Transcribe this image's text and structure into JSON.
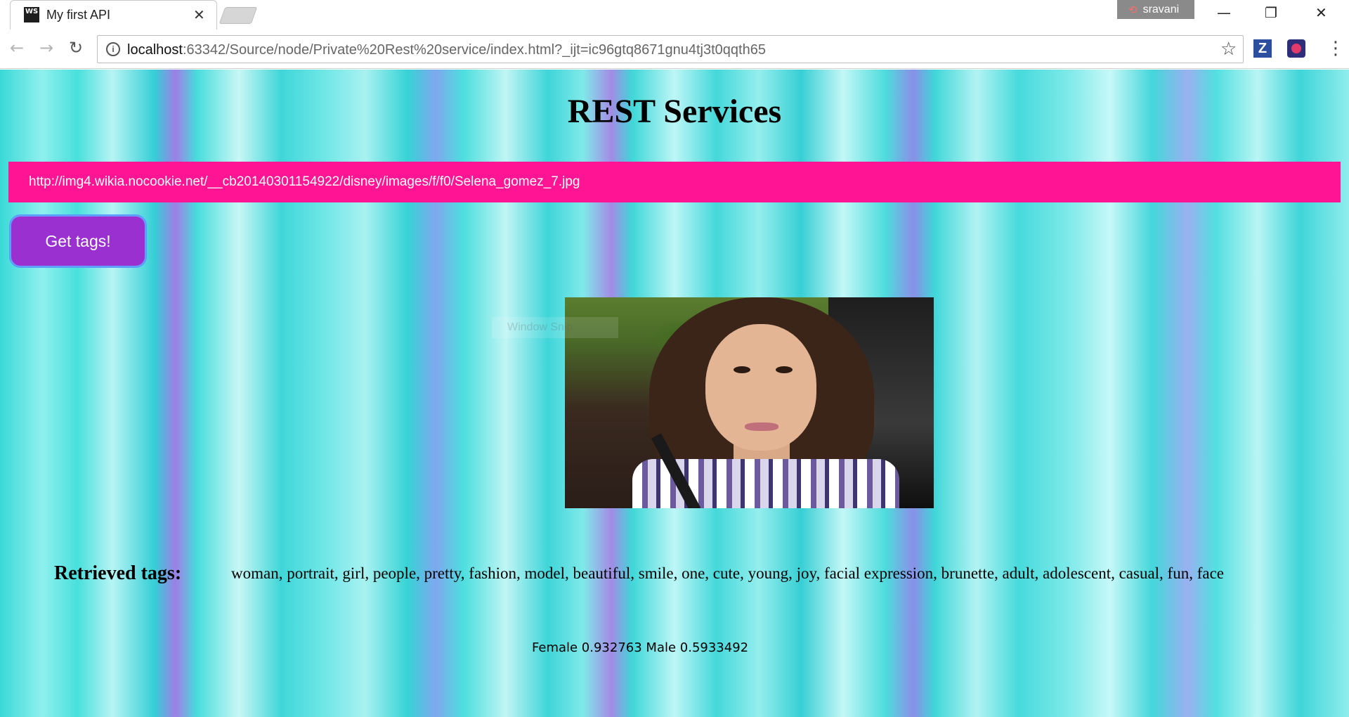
{
  "browser": {
    "tab_title": "My first API",
    "favicon_text": "WS",
    "profile_name": "sravani",
    "url_host": "localhost",
    "url_rest": ":63342/Source/node/Private%20Rest%20service/index.html?_ijt=ic96gtq8671gnu4tj3t0qqth65",
    "extensions": [
      "Z",
      "tracker-extension"
    ]
  },
  "page": {
    "title": "REST Services",
    "image_url_value": "http://img4.wikia.nocookie.net/__cb20140301154922/disney/images/f/f0/Selena_gomez_7.jpg",
    "get_tags_label": "Get tags!",
    "snip_overlay": "Window Snip",
    "tags_label": "Retrieved tags:",
    "tags_value": "woman, portrait, girl, people, pretty, fashion, model, beautiful, smile, one, cute, young, joy, facial expression, brunette, adult, adolescent, casual, fun, face",
    "gender_result": "Female 0.932763 Male 0.5933492"
  },
  "colors": {
    "url_input_bg": "#ff1493",
    "button_bg": "#9b30d0",
    "page_bg_accent": "#39d9d6"
  }
}
